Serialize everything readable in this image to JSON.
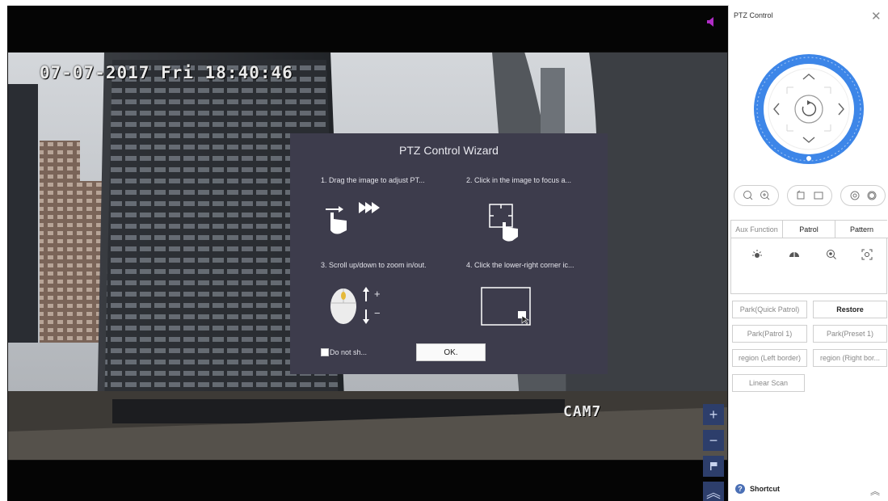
{
  "video": {
    "timestamp": "07-07-2017 Fri 18:40:46",
    "camera_label": "CAM7"
  },
  "side_controls": {
    "zoom_in": "+",
    "zoom_out": "−",
    "flag": "",
    "collapse": "︽"
  },
  "wizard": {
    "title": "PTZ Control Wizard",
    "steps": [
      "1. Drag the image to adjust PT...",
      "2. Click in the image to focus a...",
      "3. Scroll up/down to zoom in/out.",
      "4. Click the lower-right corner ic..."
    ],
    "zoom_plus": "+",
    "zoom_minus": "−",
    "do_not_show": "Do not sh...",
    "ok": "OK."
  },
  "panel": {
    "title": "PTZ Control",
    "close": "✕",
    "tabs": [
      "Aux Function",
      "Patrol",
      "Pattern"
    ],
    "buttons": {
      "park_quick": "Park(Quick Patrol)",
      "restore": "Restore",
      "park_patrol1": "Park(Patrol 1)",
      "park_preset1": "Park(Preset 1)",
      "region_left": "region (Left border)",
      "region_right": "region (Right bor...",
      "linear_scan": "Linear Scan"
    },
    "shortcut": "Shortcut",
    "collapse": "︽"
  },
  "colors": {
    "accent_blue": "#3d86e8",
    "wizard_bg": "#3d3c4c",
    "side_button": "#2d3e6b"
  }
}
